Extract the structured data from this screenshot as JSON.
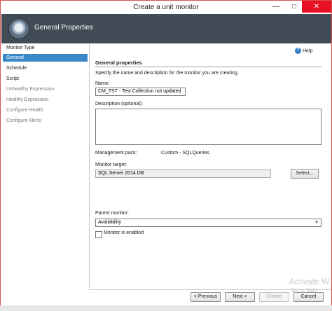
{
  "window": {
    "title": "Create a unit monitor",
    "minimize_glyph": "—",
    "maximize_glyph": "□",
    "close_glyph": "✕"
  },
  "header": {
    "title": "General Properties",
    "icon": "wizard-gear-icon"
  },
  "sidebar": {
    "items": [
      {
        "label": "Monitor Type",
        "state": "normal"
      },
      {
        "label": "General",
        "state": "selected"
      },
      {
        "label": "Schedule",
        "state": "normal"
      },
      {
        "label": "Script",
        "state": "normal"
      },
      {
        "label": "Unhealthy Expression",
        "state": "disabled"
      },
      {
        "label": "Healthy Expression",
        "state": "disabled"
      },
      {
        "label": "Configure Health",
        "state": "disabled"
      },
      {
        "label": "Configure Alerts",
        "state": "disabled"
      }
    ]
  },
  "help": {
    "label": "Help",
    "icon": "help-icon",
    "glyph": "?"
  },
  "section": {
    "title": "General properties",
    "description": "Specify the name and description for the monitor you are creating."
  },
  "form": {
    "name_label": "Name:",
    "name_value": "CM_TST - Test Collection not updated",
    "description_label": "Description (optional):",
    "description_value": "",
    "management_pack_label": "Management pack:",
    "management_pack_value": "Custom - SQLQueries",
    "monitor_target_label": "Monitor target:",
    "monitor_target_value": "SQL Server 2014 DB",
    "select_button": "Select...",
    "parent_monitor_label": "Parent monitor:",
    "parent_monitor_value": "Availability",
    "enabled_label": "Monitor is enabled",
    "enabled_checked": false
  },
  "footer": {
    "previous": "< Previous",
    "next": "Next >",
    "create": "Create",
    "cancel": "Cancel"
  },
  "watermark": {
    "line1": "Activate W",
    "line2": "Go to Setti"
  }
}
